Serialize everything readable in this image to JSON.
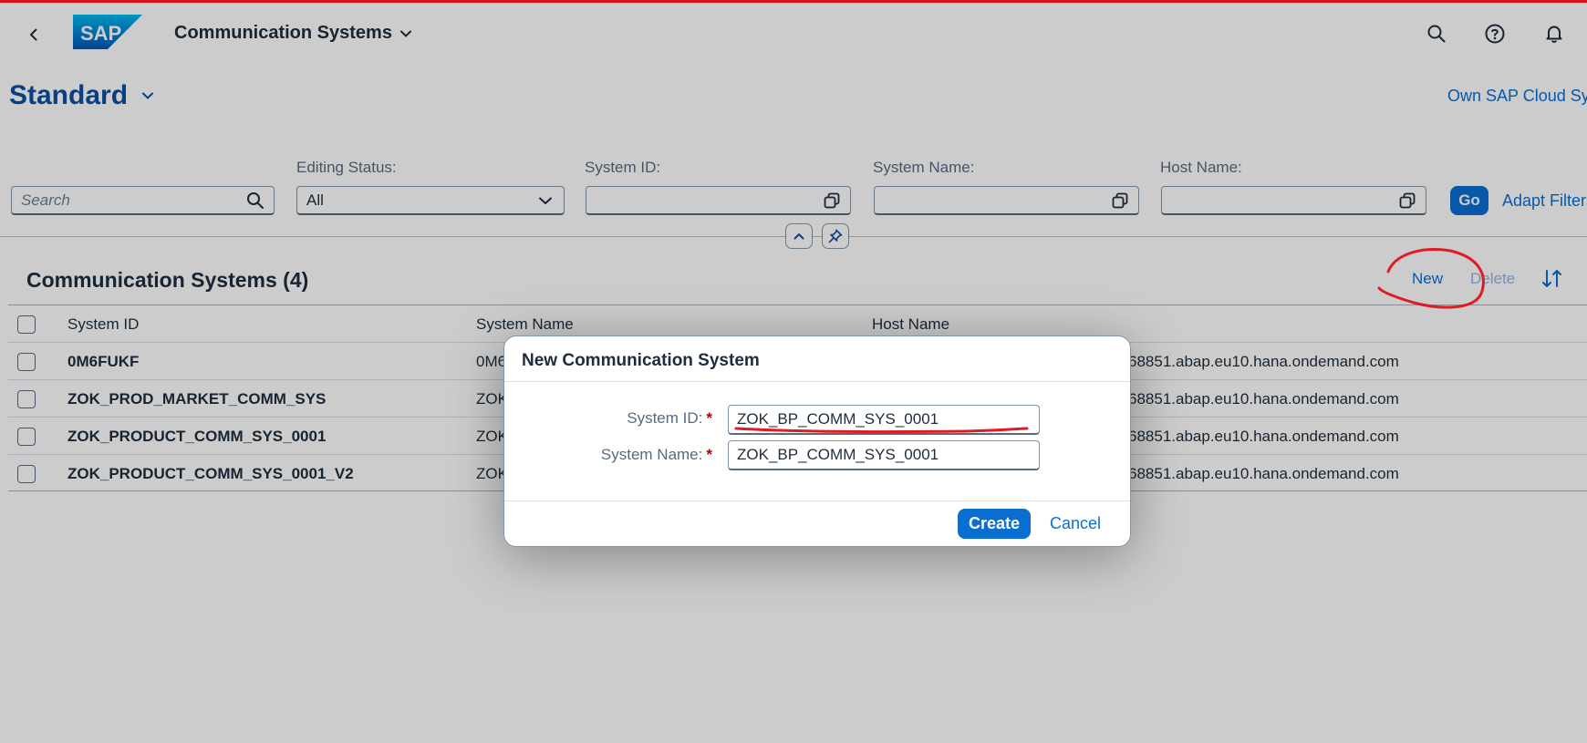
{
  "shell": {
    "app_title": "Communication Systems",
    "logo_text": "SAP",
    "icons": [
      "back-icon",
      "chevron-down-icon",
      "search-icon",
      "help-icon",
      "bell-icon"
    ]
  },
  "header": {
    "variant_name": "Standard",
    "right_link": "Own SAP Cloud System"
  },
  "filters": {
    "search_placeholder": "Search",
    "editing_status_label": "Editing Status:",
    "editing_status_value": "All",
    "system_id_label": "System ID:",
    "system_name_label": "System Name:",
    "host_name_label": "Host Name:",
    "go_label": "Go",
    "adapt_label": "Adapt Filters"
  },
  "table": {
    "title": "Communication Systems (4)",
    "new_label": "New",
    "delete_label": "Delete",
    "columns": [
      "System ID",
      "System Name",
      "Host Name"
    ],
    "rows": [
      {
        "system_id": "0M6FUKF",
        "system_name": "0M6",
        "host_name": "68851.abap.eu10.hana.ondemand.com"
      },
      {
        "system_id": "ZOK_PROD_MARKET_COMM_SYS",
        "system_name": "ZOK",
        "host_name": "68851.abap.eu10.hana.ondemand.com"
      },
      {
        "system_id": "ZOK_PRODUCT_COMM_SYS_0001",
        "system_name": "ZOK",
        "host_name": "68851.abap.eu10.hana.ondemand.com"
      },
      {
        "system_id": "ZOK_PRODUCT_COMM_SYS_0001_V2",
        "system_name": "ZOK",
        "host_name": "68851.abap.eu10.hana.ondemand.com"
      }
    ]
  },
  "dialog": {
    "title": "New Communication System",
    "system_id_label": "System ID:",
    "system_id_value": "ZOK_BP_COMM_SYS_0001",
    "system_name_label": "System Name:",
    "system_name_value": "ZOK_BP_COMM_SYS_0001",
    "required_marker": "*",
    "create_label": "Create",
    "cancel_label": "Cancel"
  },
  "colors": {
    "brand_blue": "#0a6ed1",
    "variant_blue": "#0a4fa3",
    "annotation_red": "#e01b24",
    "top_line_red": "#d8101b"
  }
}
